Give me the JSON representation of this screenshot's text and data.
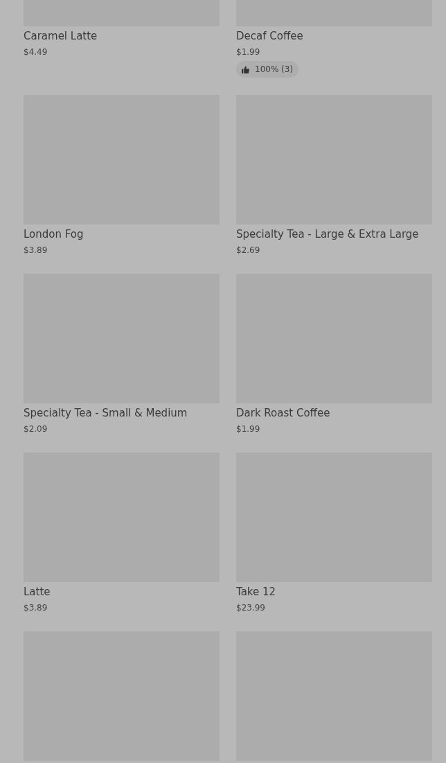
{
  "products": [
    {
      "kind": "product",
      "name": "Caramel Latte",
      "price": "$4.49"
    },
    {
      "kind": "product",
      "name": "Decaf Coffee",
      "price": "$1.99",
      "rating": "100% (3)"
    },
    {
      "kind": "product",
      "name": "London Fog",
      "price": "$3.89"
    },
    {
      "kind": "product",
      "name": "Specialty Tea - Large & Extra Large",
      "price": "$2.69"
    },
    {
      "kind": "product",
      "name": "Specialty Tea - Small & Medium",
      "price": "$2.09"
    },
    {
      "kind": "product",
      "name": "Dark Roast Coffee",
      "price": "$1.99"
    },
    {
      "kind": "product",
      "name": "Latte",
      "price": "$3.89"
    },
    {
      "kind": "product",
      "name": "Take 12",
      "price": "$23.99"
    },
    {
      "kind": "image_only"
    },
    {
      "kind": "image_only"
    }
  ]
}
